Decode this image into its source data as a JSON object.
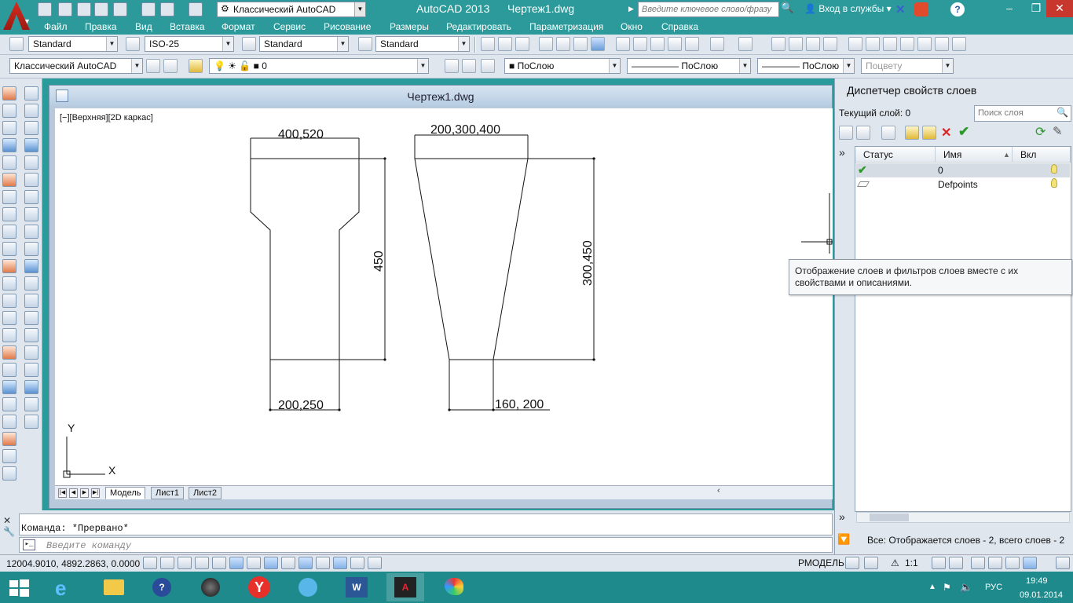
{
  "titlebar": {
    "app_name": "AutoCAD 2013",
    "document": "Чертеж1.dwg",
    "workspace": "Классический AutoCAD",
    "search_placeholder": "Введите ключевое слово/фразу",
    "signin": "Вход в службы",
    "help": "?"
  },
  "menu": [
    "Файл",
    "Правка",
    "Вид",
    "Вставка",
    "Формат",
    "Сервис",
    "Рисование",
    "Размеры",
    "Редактировать",
    "Параметризация",
    "Окно",
    "Справка"
  ],
  "styles_toolbar": {
    "text_style": "Standard",
    "dim_style": "ISO-25",
    "table_style": "Standard",
    "mleader_style": "Standard"
  },
  "layers_toolbar": {
    "workspace": "Классический AutoCAD",
    "current_layer": "0",
    "color": "ПоСлою",
    "linetype": "ПоСлою",
    "lineweight": "ПоСлою",
    "plotstyle": "Поцвету"
  },
  "drawing": {
    "window_title": "Чертеж1.dwg",
    "view_label": "[−][Верхняя][2D каркас]",
    "dimensions": {
      "left_top": "400,520",
      "left_height": "450",
      "left_bottom": "200,250",
      "right_top": "200,300,400",
      "right_height": "300,450",
      "right_bottom": "160, 200"
    },
    "ucs": {
      "x": "X",
      "y": "Y"
    },
    "tabs": [
      "Модель",
      "Лист1",
      "Лист2"
    ]
  },
  "layer_panel": {
    "title": "Диспетчер свойств слоев",
    "current_layer": "Текущий слой: 0",
    "search_placeholder": "Поиск слоя",
    "columns": [
      "Статус",
      "Имя",
      "Вкл"
    ],
    "rows": [
      {
        "name": "0",
        "status": "current"
      },
      {
        "name": "Defpoints",
        "status": "layer"
      }
    ],
    "status_text": "Все: Отображается слоев - 2, всего слоев - 2"
  },
  "tooltip": "Отображение слоев и фильтров слоев вместе с их свойствами и описаниями.",
  "command": {
    "history": "Команда:  *Прервано*",
    "placeholder": "Введите команду"
  },
  "statusbar": {
    "coords": "12004.9010, 4892.2863, 0.0000",
    "model": "РМОДЕЛЬ",
    "scale": "1:1"
  },
  "taskbar": {
    "lang": "РУС",
    "time": "19:49",
    "date": "09.01.2014"
  },
  "colors": {
    "titlebar": "#2c9a9a",
    "toolbar": "#dfe6ee",
    "canvas": "#ffffff",
    "taskbar": "#1f8a8c",
    "close": "#c7372d"
  }
}
